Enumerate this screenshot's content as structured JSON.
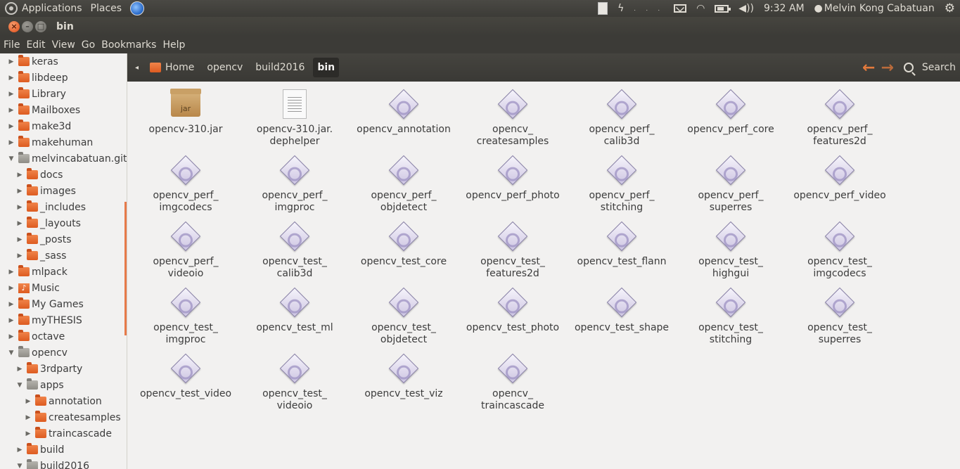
{
  "top_panel": {
    "applications": "Applications",
    "places": "Places",
    "time": "9:32 AM",
    "user": "Melvin Kong Cabatuan"
  },
  "window": {
    "title": "bin"
  },
  "menubar": [
    "File",
    "Edit",
    "View",
    "Go",
    "Bookmarks",
    "Help"
  ],
  "sidebar": {
    "items": [
      {
        "label": "keras",
        "expanded": false,
        "level": 0
      },
      {
        "label": "libdeep",
        "expanded": false,
        "level": 0
      },
      {
        "label": "Library",
        "expanded": false,
        "level": 0
      },
      {
        "label": "Mailboxes",
        "expanded": false,
        "level": 0
      },
      {
        "label": "make3d",
        "expanded": false,
        "level": 0
      },
      {
        "label": "makehuman",
        "expanded": false,
        "level": 0
      },
      {
        "label": "melvincabatuan.gith",
        "expanded": true,
        "level": 0
      },
      {
        "label": "docs",
        "expanded": false,
        "level": 1
      },
      {
        "label": "images",
        "expanded": false,
        "level": 1
      },
      {
        "label": "_includes",
        "expanded": false,
        "level": 1
      },
      {
        "label": "_layouts",
        "expanded": false,
        "level": 1
      },
      {
        "label": "_posts",
        "expanded": false,
        "level": 1
      },
      {
        "label": "_sass",
        "expanded": false,
        "level": 1
      },
      {
        "label": "mlpack",
        "expanded": false,
        "level": 0
      },
      {
        "label": "Music",
        "expanded": false,
        "level": 0
      },
      {
        "label": "My Games",
        "expanded": false,
        "level": 0
      },
      {
        "label": "myTHESIS",
        "expanded": false,
        "level": 0
      },
      {
        "label": "octave",
        "expanded": false,
        "level": 0
      },
      {
        "label": "opencv",
        "expanded": true,
        "level": 0
      },
      {
        "label": "3rdparty",
        "expanded": false,
        "level": 1
      },
      {
        "label": "apps",
        "expanded": true,
        "level": 1
      },
      {
        "label": "annotation",
        "expanded": false,
        "level": 2
      },
      {
        "label": "createsamples",
        "expanded": false,
        "level": 2
      },
      {
        "label": "traincascade",
        "expanded": false,
        "level": 2
      },
      {
        "label": "build",
        "expanded": false,
        "level": 1
      },
      {
        "label": "build2016",
        "expanded": true,
        "level": 1
      }
    ]
  },
  "pathbar": {
    "crumbs": [
      "Home",
      "opencv",
      "build2016",
      "bin"
    ],
    "search_label": "Search"
  },
  "files": [
    {
      "name": "opencv-310.jar",
      "type": "jar",
      "jar_label": "jar"
    },
    {
      "name": "opencv-310.jar.\ndephelper",
      "type": "text"
    },
    {
      "name": "opencv_annotation",
      "type": "exe"
    },
    {
      "name": "opencv_\ncreatesamples",
      "type": "exe"
    },
    {
      "name": "opencv_perf_\ncalib3d",
      "type": "exe"
    },
    {
      "name": "opencv_perf_core",
      "type": "exe"
    },
    {
      "name": "opencv_perf_\nfeatures2d",
      "type": "exe"
    },
    {
      "name": "opencv_perf_\nimgcodecs",
      "type": "exe"
    },
    {
      "name": "opencv_perf_\nimgproc",
      "type": "exe"
    },
    {
      "name": "opencv_perf_\nobjdetect",
      "type": "exe"
    },
    {
      "name": "opencv_perf_photo",
      "type": "exe"
    },
    {
      "name": "opencv_perf_\nstitching",
      "type": "exe"
    },
    {
      "name": "opencv_perf_\nsuperres",
      "type": "exe"
    },
    {
      "name": "opencv_perf_video",
      "type": "exe"
    },
    {
      "name": "opencv_perf_\nvideoio",
      "type": "exe"
    },
    {
      "name": "opencv_test_\ncalib3d",
      "type": "exe"
    },
    {
      "name": "opencv_test_core",
      "type": "exe"
    },
    {
      "name": "opencv_test_\nfeatures2d",
      "type": "exe"
    },
    {
      "name": "opencv_test_flann",
      "type": "exe"
    },
    {
      "name": "opencv_test_\nhighgui",
      "type": "exe"
    },
    {
      "name": "opencv_test_\nimgcodecs",
      "type": "exe"
    },
    {
      "name": "opencv_test_\nimgproc",
      "type": "exe"
    },
    {
      "name": "opencv_test_ml",
      "type": "exe"
    },
    {
      "name": "opencv_test_\nobjdetect",
      "type": "exe"
    },
    {
      "name": "opencv_test_photo",
      "type": "exe"
    },
    {
      "name": "opencv_test_shape",
      "type": "exe"
    },
    {
      "name": "opencv_test_\nstitching",
      "type": "exe"
    },
    {
      "name": "opencv_test_\nsuperres",
      "type": "exe"
    },
    {
      "name": "opencv_test_video",
      "type": "exe"
    },
    {
      "name": "opencv_test_\nvideoio",
      "type": "exe"
    },
    {
      "name": "opencv_test_viz",
      "type": "exe"
    },
    {
      "name": "opencv_\ntraincascade",
      "type": "exe"
    }
  ]
}
